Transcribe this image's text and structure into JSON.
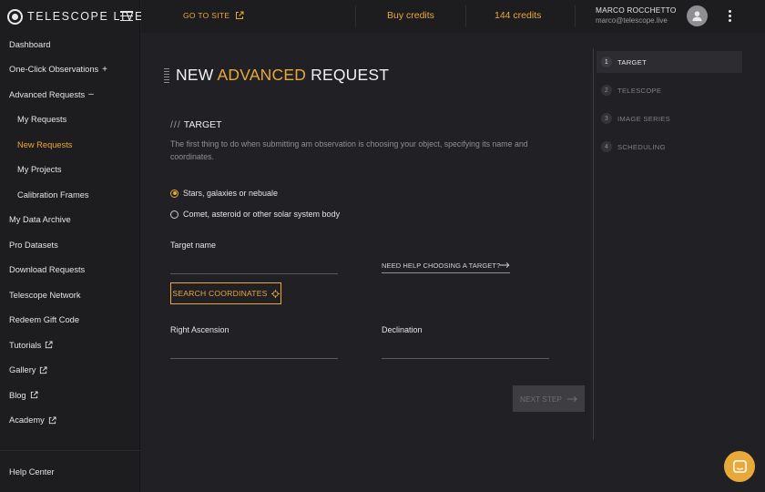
{
  "brand": {
    "name": "TELESCOPE LIVE"
  },
  "sidebar": {
    "items": [
      {
        "label": "Dashboard"
      },
      {
        "label": "One-Click Observations",
        "suffix": "+"
      },
      {
        "label": "Advanced Requests",
        "suffix": "–"
      },
      {
        "label": "My Requests"
      },
      {
        "label": "New Requests"
      },
      {
        "label": "My Projects"
      },
      {
        "label": "Calibration Frames"
      },
      {
        "label": "My Data Archive"
      },
      {
        "label": "Pro Datasets"
      },
      {
        "label": "Download Requests"
      },
      {
        "label": "Telescope Network"
      },
      {
        "label": "Redeem Gift Code"
      },
      {
        "label": "Tutorials"
      },
      {
        "label": "Gallery"
      },
      {
        "label": "Blog"
      },
      {
        "label": "Academy"
      }
    ],
    "help_label": "Help Center"
  },
  "topbar": {
    "goto_label": "GO TO SITE",
    "buy_label": "Buy credits",
    "credits_label": "144 credits",
    "user_name": "MARCO ROCCHETTO",
    "user_email": "marco@telescope.live"
  },
  "main": {
    "title_pre": "NEW ",
    "title_highlight": "ADVANCED",
    "title_post": " REQUEST",
    "section_slashes": "///",
    "section_title": "TARGET",
    "description": "The first thing to do when submitting am observation is choosing your object, specifying its name and coordinates.",
    "radio_options": [
      {
        "label": "Stars, galaxies or nebuale",
        "checked": true
      },
      {
        "label": "Comet, asteroid or other solar system body",
        "checked": false
      }
    ],
    "target_name_label": "Target name",
    "help_link_label": "NEED HELP CHOOSING A TARGET?",
    "search_button_label": "SEARCH COORDINATES",
    "ra_label": "Right Ascension",
    "dec_label": "Declination",
    "next_button_label": "NEXT STEP"
  },
  "steps": [
    {
      "num": "1",
      "label": "TARGET",
      "active": true
    },
    {
      "num": "2",
      "label": "TELESCOPE",
      "active": false
    },
    {
      "num": "3",
      "label": "IMAGE SERIES",
      "active": false
    },
    {
      "num": "4",
      "label": "SCHEDULING",
      "active": false
    }
  ],
  "colors": {
    "accent": "#e9a93a",
    "background": "#212125",
    "sidebar": "#1d1d20"
  },
  "icons": {
    "menu": "hamburger-icon",
    "external": "external-link-icon",
    "user": "user-icon",
    "more": "kebab-icon",
    "arrow": "arrow-right-icon",
    "crosshair": "crosshair-icon",
    "chat": "chat-icon"
  }
}
